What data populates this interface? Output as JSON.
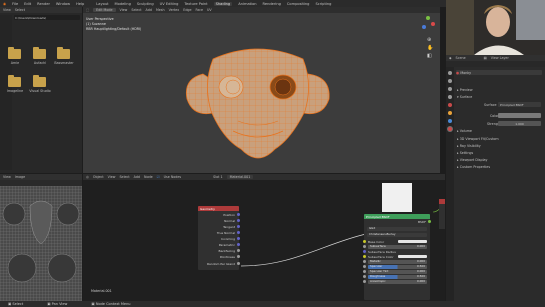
{
  "menubar": {
    "items": [
      "File",
      "Edit",
      "Render",
      "Window",
      "Help"
    ],
    "workspaces": [
      "Layout",
      "Modeling",
      "Sculpting",
      "UV Editing",
      "Texture Paint",
      "Shading",
      "Animation",
      "Rendering",
      "Compositing",
      "Scripting"
    ],
    "active_workspace": "Shading"
  },
  "file_browser": {
    "menu": [
      "View",
      "Select"
    ],
    "path": "C:\\Users\\Downloads\\",
    "folders": [
      "Amie",
      "Aufachl",
      "Bassmaster",
      "Imageline",
      "Visual Studio"
    ]
  },
  "viewport": {
    "mode": "Edit Mode",
    "menu": [
      "View",
      "Select",
      "Add",
      "Mesh",
      "Vertex",
      "Edge",
      "Face",
      "UV"
    ],
    "overlay_lines": [
      "User Perspective",
      "(1) Suzanne",
      "RBR Hauptlighting/Default (HDRI)"
    ]
  },
  "outliner": {
    "scene_label": "Scene",
    "view_layer_label": "View Layer"
  },
  "properties": {
    "object_name": "Monky",
    "sections_top": [
      "Preview",
      "Surface"
    ],
    "surface_label": "Surface",
    "surface_value": "Principled BSDF",
    "base_color_label": "Color",
    "strength_label": "Strength",
    "strength_value": "1.000",
    "sections_bottom": [
      "Volume",
      "3D Viewport Fit/Custom",
      "Ray Visibility",
      "Settings",
      "Viewport Display",
      "Custom Properties"
    ]
  },
  "uv_editor": {
    "menu": [
      "View",
      "Image"
    ]
  },
  "node_editor": {
    "menu": [
      "Object",
      "View",
      "Select",
      "Add",
      "Node",
      "Use Nodes"
    ],
    "slot_label": "Slot 1",
    "material_label": "Material.001",
    "footer_label": "Material.001",
    "geometry_node": {
      "title": "Geometry",
      "outputs": [
        "Position",
        "Normal",
        "Tangent",
        "True Normal",
        "Incoming",
        "Parametric",
        "Backfacing",
        "Pointiness",
        "Random Per Island"
      ]
    },
    "bsdf_node": {
      "title": "Principled BSDF",
      "output": "BSDF",
      "dropdown_1": "GGX",
      "dropdown_2": "Christensen-Burley",
      "rows": [
        "Base Color",
        "Subsurface",
        "Subsurface Radius",
        "Subsurface Color",
        "Metallic",
        "Specular",
        "Specular Tint",
        "Roughness",
        "Anisotropic"
      ],
      "values": [
        "",
        "0.000",
        "",
        "",
        "0.000",
        "0.500",
        "0.000",
        "0.500",
        "0.000"
      ]
    }
  },
  "statusbar": {
    "items": [
      "Select",
      "Pan View",
      "Node Context Menu"
    ]
  },
  "colors": {
    "accent_orange": "#e8731e",
    "mesh_face": "#c9a07c",
    "node_header_red": "#ad3a3a",
    "node_header_green": "#3e9e5a",
    "socket_purple": "#6363c7"
  }
}
